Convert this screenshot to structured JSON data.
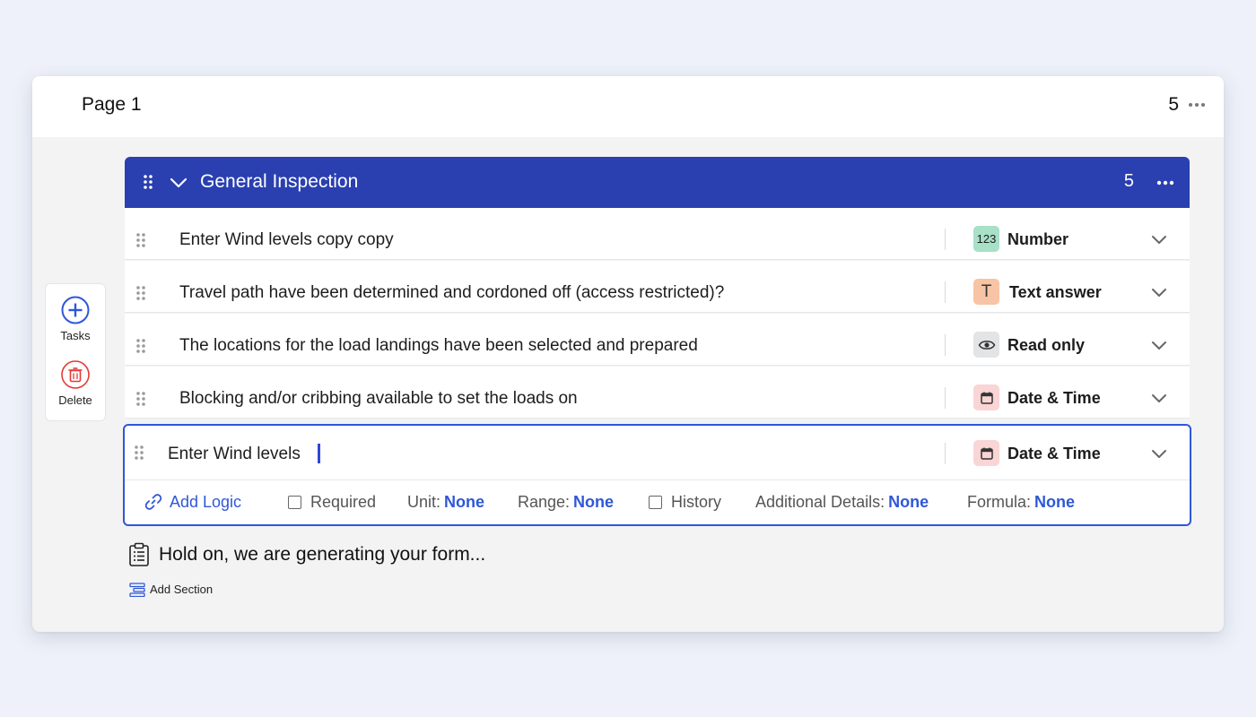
{
  "page": {
    "title": "Page 1",
    "count": "5"
  },
  "toolbox": {
    "tasks_label": "Tasks",
    "delete_label": "Delete"
  },
  "section": {
    "title": "General Inspection",
    "count": "5"
  },
  "questions": [
    {
      "text": "Enter Wind levels copy copy",
      "type": "Number",
      "badge_text": "123",
      "badge_color": "#a8e0c8"
    },
    {
      "text": "Travel path have been determined and cordoned off (access restricted)?",
      "type": "Text answer",
      "badge_text": "T",
      "badge_color": "#f7c4a5"
    },
    {
      "text": "The locations for the load landings have been selected and prepared",
      "type": "Read only",
      "badge_text": "",
      "badge_color": "#e3e4e6"
    },
    {
      "text": "Blocking and/or cribbing available to set the loads on",
      "type": "Date & Time",
      "badge_text": "",
      "badge_color": "#f9d5d5"
    }
  ],
  "active_question": {
    "value": "Enter Wind levels",
    "type": "Date & Time",
    "badge_color": "#f9d5d5",
    "options": {
      "add_logic": "Add Logic",
      "required": "Required",
      "unit_label": "Unit:",
      "unit_value": "None",
      "range_label": "Range:",
      "range_value": "None",
      "history": "History",
      "details_label": "Additional Details:",
      "details_value": "None",
      "formula_label": "Formula:",
      "formula_value": "None"
    }
  },
  "status": {
    "generating": "Hold on, we are generating your form..."
  },
  "add_section_label": "Add Section",
  "colors": {
    "accent": "#2a3fb0",
    "link": "#2f57d8",
    "delete": "#e53935",
    "background": "#eef1f9"
  }
}
